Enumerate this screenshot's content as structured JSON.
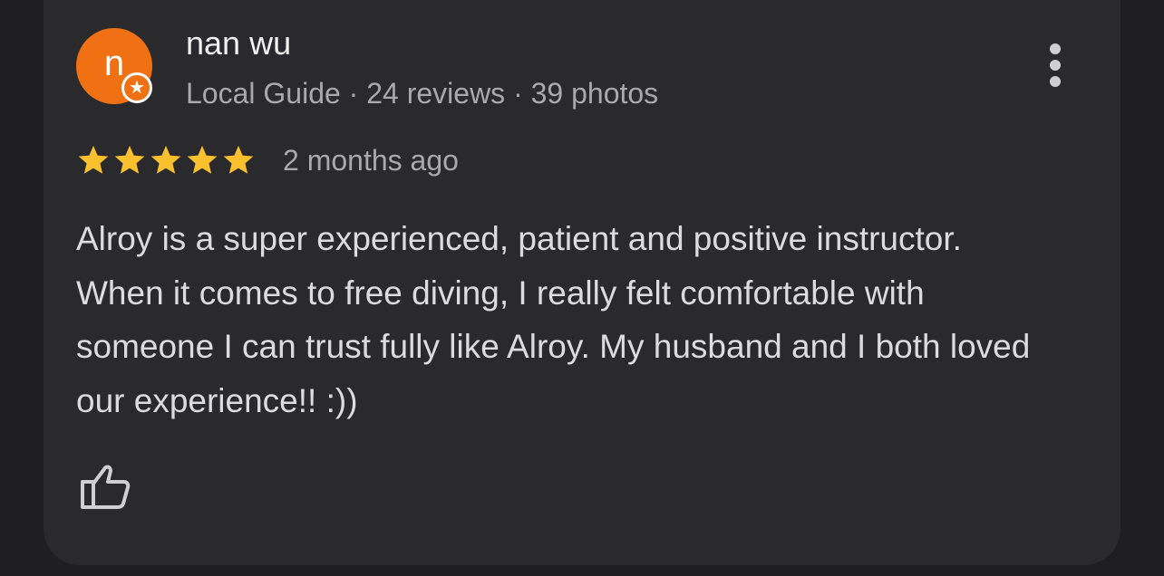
{
  "review": {
    "author_name": "nan wu",
    "avatar_initial": "n",
    "author_meta": "Local Guide · 24 reviews · 39 photos",
    "rating": 5,
    "rating_max": 5,
    "time_ago": "2 months ago",
    "text": "Alroy is a super experienced, patient and positive instructor. When it comes to free diving, I really felt comfortable with someone I can trust fully like Alroy. My husband and I both loved our experience!! :))"
  },
  "icons": {
    "badge": "local-guide-star-icon",
    "more": "more-vert-icon",
    "star": "star-icon",
    "like": "thumb-up-icon"
  },
  "colors": {
    "avatar": "#f07114",
    "star": "#fbc02d",
    "card_bg": "#2a2a2c",
    "page_bg": "#1f1f21"
  }
}
